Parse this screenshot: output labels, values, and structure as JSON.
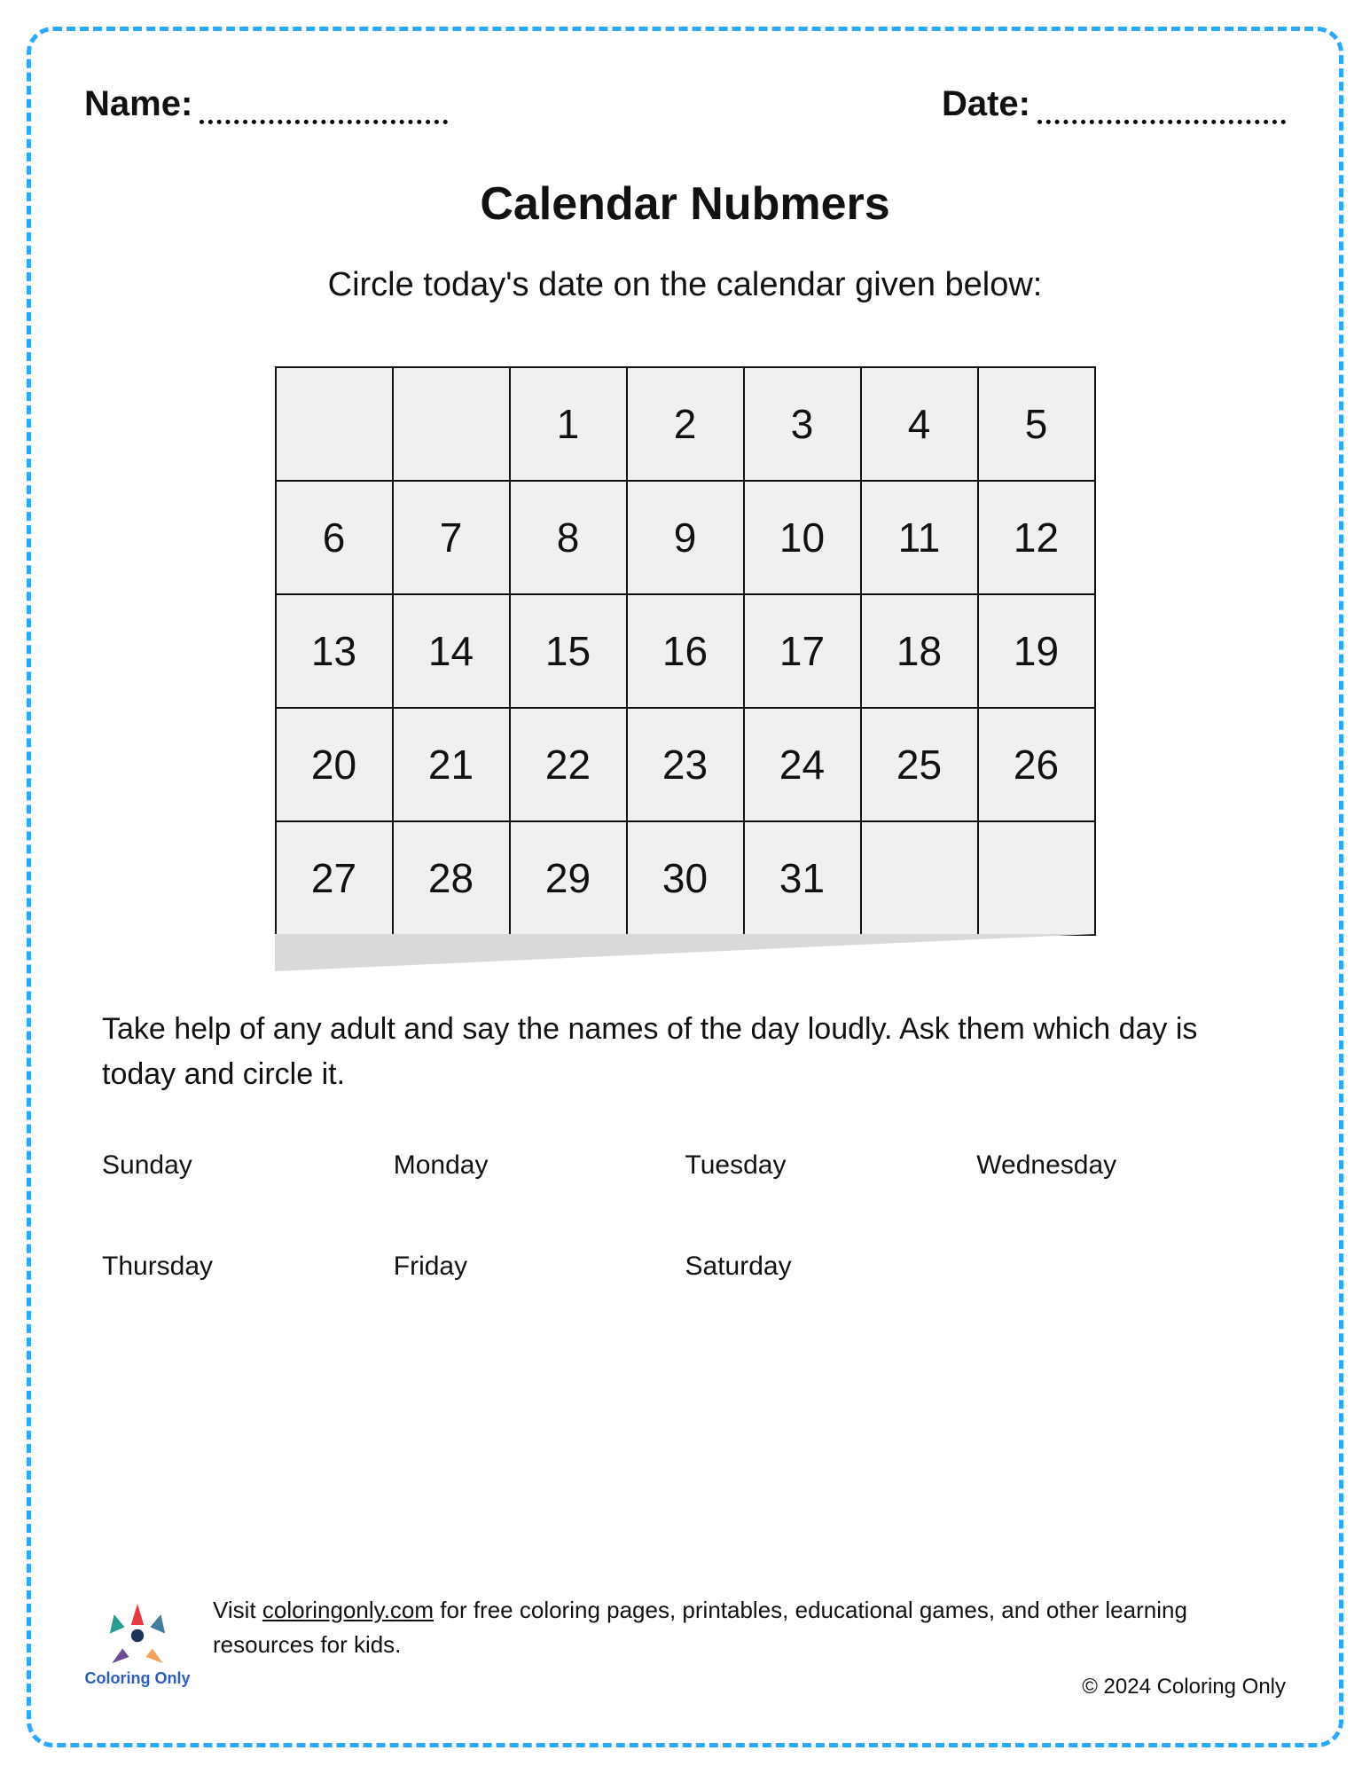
{
  "header": {
    "name_label": "Name:",
    "date_label": "Date:"
  },
  "title": "Calendar Nubmers",
  "instruction1": "Circle today's date on the calendar given below:",
  "calendar": [
    [
      "",
      "",
      "1",
      "2",
      "3",
      "4",
      "5"
    ],
    [
      "6",
      "7",
      "8",
      "9",
      "10",
      "11",
      "12"
    ],
    [
      "13",
      "14",
      "15",
      "16",
      "17",
      "18",
      "19"
    ],
    [
      "20",
      "21",
      "22",
      "23",
      "24",
      "25",
      "26"
    ],
    [
      "27",
      "28",
      "29",
      "30",
      "31",
      "",
      ""
    ]
  ],
  "instruction2": "Take help of any adult and say the names of the day loudly. Ask them which day is today and circle it.",
  "days": [
    "Sunday",
    "Monday",
    "Tuesday",
    "Wednesday",
    "Thursday",
    "Friday",
    "Saturday"
  ],
  "footer": {
    "logo_text": "Coloring Only",
    "text_before": "Visit ",
    "link_text": "coloringonly.com",
    "text_after": " for free coloring pages, printables, educational games, and other learning resources for kids.",
    "copyright": "© 2024 Coloring Only"
  }
}
